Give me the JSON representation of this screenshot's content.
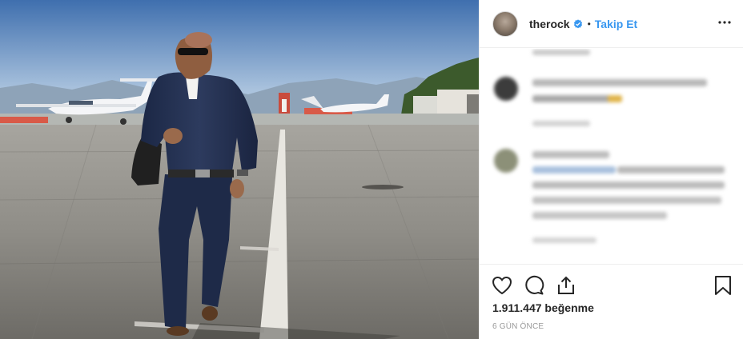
{
  "post": {
    "photo": {
      "description_icon": "photo-airport-runway",
      "sky_top": "#3f6fae",
      "sky_bottom": "#b9cfe4",
      "tarmac": "#8e8c86"
    }
  },
  "header": {
    "username": "therock",
    "verified_icon": "verified-badge-icon",
    "separator": "•",
    "follow_label": "Takip Et",
    "more_icon": "more-options-icon"
  },
  "actions": {
    "like_icon": "heart-icon",
    "comment_icon": "comment-icon",
    "share_icon": "share-icon",
    "save_icon": "bookmark-icon"
  },
  "stats": {
    "likes_text": "1.911.447 beğenme",
    "time_text": "6 GÜN ÖNCE"
  },
  "colors": {
    "accent": "#3897f0",
    "text": "#262626",
    "muted": "#999999",
    "border": "#efefef"
  }
}
